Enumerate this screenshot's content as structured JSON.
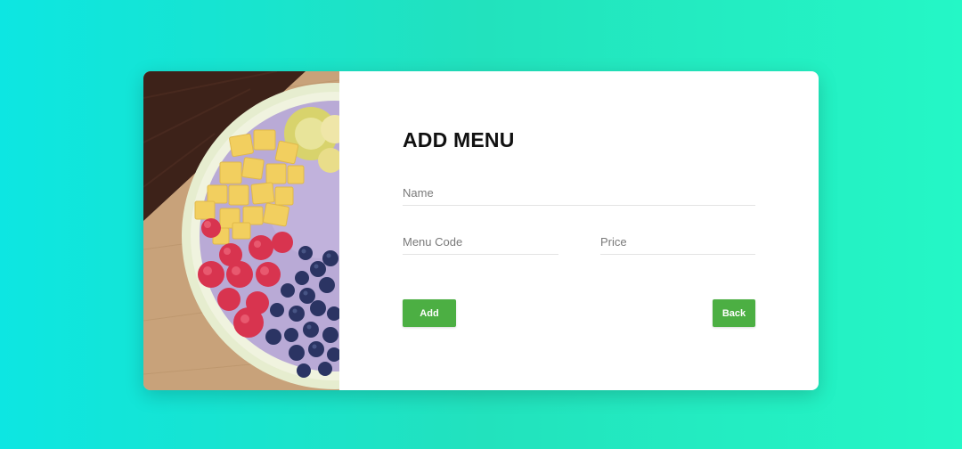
{
  "form": {
    "title": "ADD MENU",
    "name_placeholder": "Name",
    "menu_code_placeholder": "Menu Code",
    "price_placeholder": "Price",
    "add_label": "Add",
    "back_label": "Back"
  },
  "colors": {
    "background_start": "#0de6e2",
    "background_end": "#24f7c6",
    "button": "#4caf43",
    "card": "#ffffff"
  },
  "image": {
    "semantic": "smoothie-bowl-with-fruit-photo"
  }
}
